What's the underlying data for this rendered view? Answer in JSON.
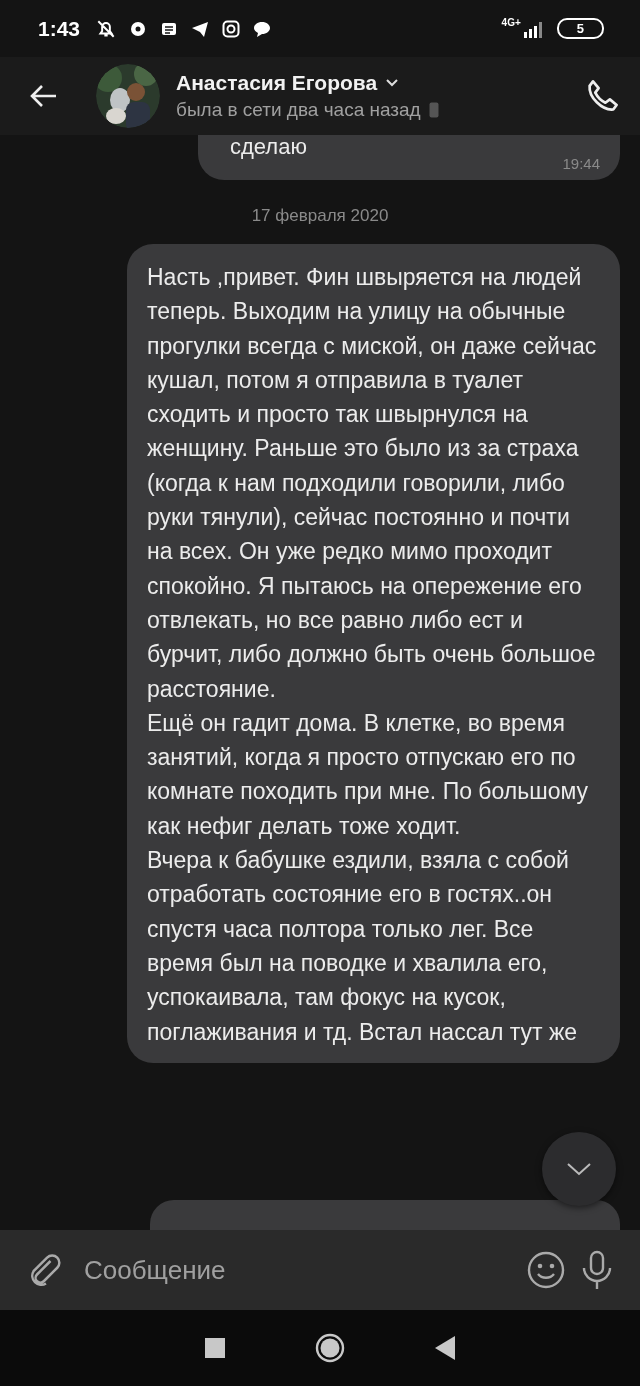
{
  "status_bar": {
    "time": "1:43",
    "network": "4G+",
    "battery": "5"
  },
  "header": {
    "name": "Анастасия Егорова",
    "status": "была в сети два часа назад"
  },
  "messages": [
    {
      "kind": "bubble",
      "text": "сделаю",
      "time": "19:44"
    },
    {
      "kind": "date",
      "text": "17 февраля 2020"
    },
    {
      "kind": "bubble",
      "text": "Насть ,привет. Фин швыряется на людей теперь. Выходим на улицу на обычные прогулки всегда с миской, он даже сейчас кушал, потом я отправила в туалет сходить и просто так швырнулся на женщину. Раньше это было из за страха (когда к нам подходили говорили, либо руки тянули), сейчас постоянно и почти на всех. Он уже редко мимо проходит спокойно. Я пытаюсь на опережение его отвлекать, но все равно либо ест и бурчит, либо должно быть очень большое расстояние.\nЕщё он гадит дома. В клетке, во время занятий, когда я просто отпускаю его по комнате походить при мне. По большому как нефиг делать тоже ходит.\nВчера к бабушке ездили, взяла с собой отработать состояние его в гостях..он спустя часа полтора только лег. Все время был на поводке и хвалила его, успокаивала, там фокус на кусок, поглаживания и тд. Встал нассал тут же"
    },
    {
      "kind": "partial"
    }
  ],
  "composer": {
    "placeholder": "Сообщение"
  }
}
